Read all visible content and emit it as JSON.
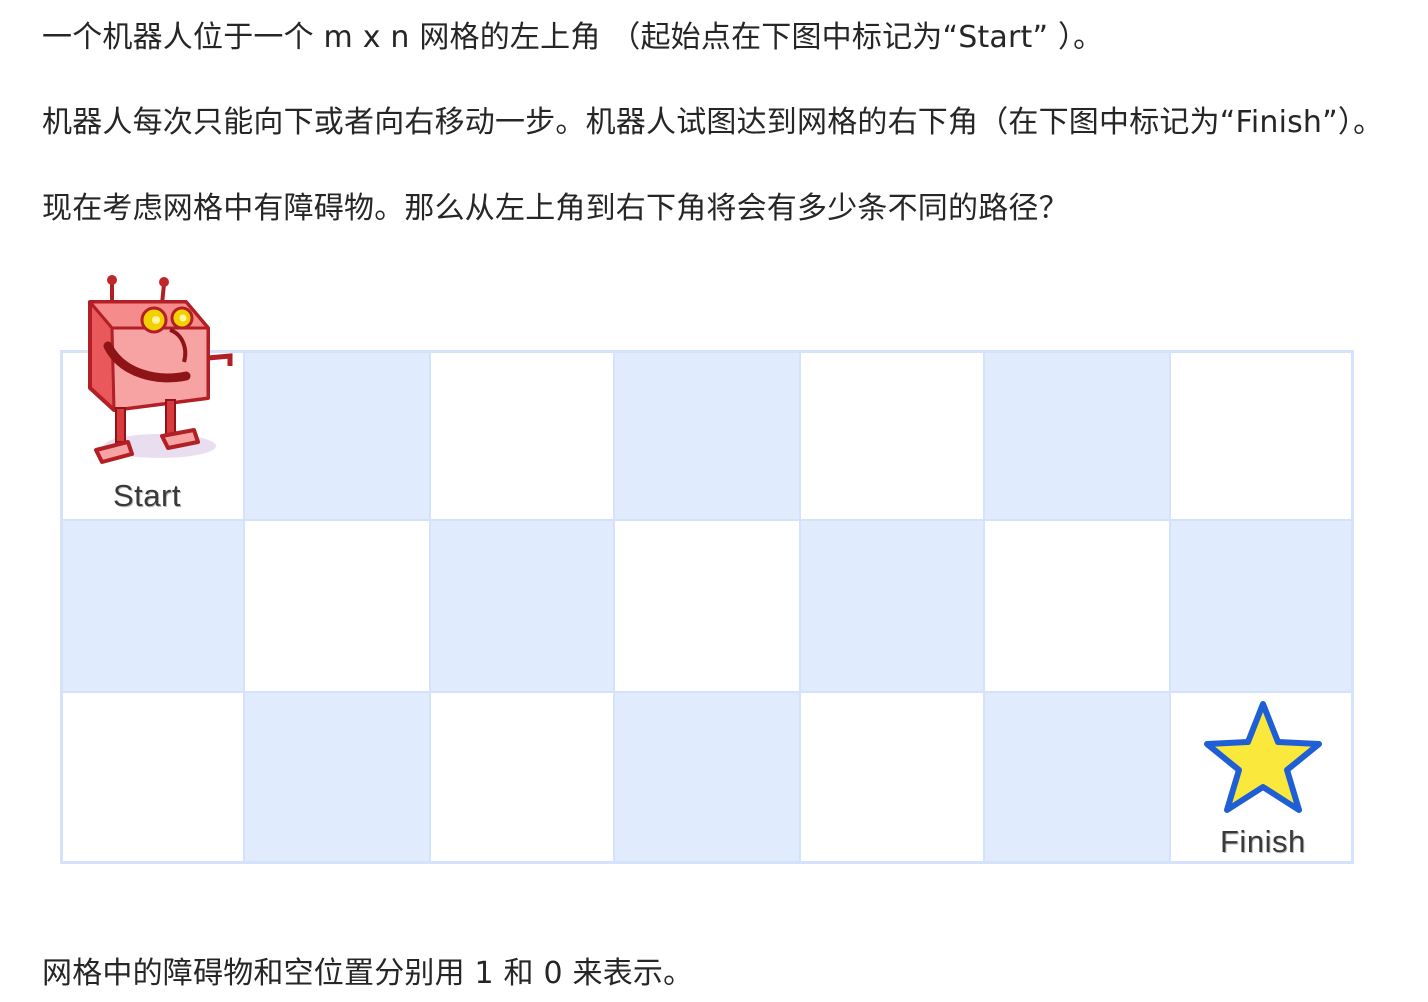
{
  "paragraphs": {
    "intro": "一个机器人位于一个 m x n 网格的左上角 （起始点在下图中标记为“Start” ）。",
    "movement": "机器人每次只能向下或者向右移动一步。机器人试图达到网格的右下角（在下图中标记为“Finish”）。",
    "question": "现在考虑网格中有障碍物。那么从左上角到右下角将会有多少条不同的路径？",
    "encoding": "网格中的障碍物和空位置分别用 1 和 0 来表示。"
  },
  "grid": {
    "rows": 3,
    "cols": 7,
    "start_label": "Start",
    "finish_label": "Finish",
    "colors": {
      "light_blue": "#e0ebfd",
      "white": "#ffffff",
      "border": "#d4e2fb"
    },
    "robot_icon": "robot-icon",
    "star_icon": "star-icon"
  }
}
